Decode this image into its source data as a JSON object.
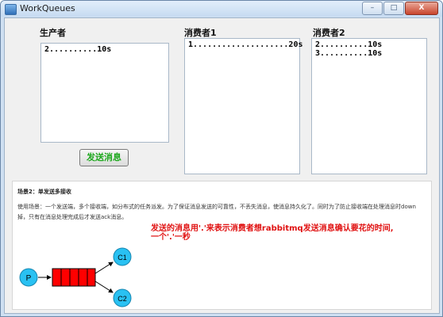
{
  "window": {
    "title": "WorkQueues",
    "app_icon": "app-icon",
    "buttons": {
      "minimize": "–",
      "maximize": "□",
      "close": "X"
    }
  },
  "producer": {
    "label": "生产者",
    "lines": [
      "2..........10s"
    ]
  },
  "consumer1": {
    "label": "消费者1",
    "lines": [
      "1....................20s"
    ]
  },
  "consumer2": {
    "label": "消费者2",
    "lines": [
      "2..........10s",
      "3..........10s"
    ]
  },
  "send_button": {
    "label": "发送消息",
    "color": "#1ea81e"
  },
  "doc": {
    "title": "场景2：单发送多接收",
    "paragraph": "使用场景：一个发送端，多个接收端，如分布式的任务派发。为了保证消息发送的可靠性，不丢失消息，使消息持久化了。同时为了防止接收端在处理消息时down掉，只有在消息处理完成后才发送ack消息。",
    "note": "发送的消息用'.'来表示消费者想rabbitmq发送消息确认要花的时间,一个'.'一秒",
    "note_color": "#e01010",
    "diagram": {
      "producer": "P",
      "consumers": [
        "C1",
        "C2"
      ],
      "node_color": "#29c1f2",
      "queue_color": "#ff0000"
    }
  }
}
